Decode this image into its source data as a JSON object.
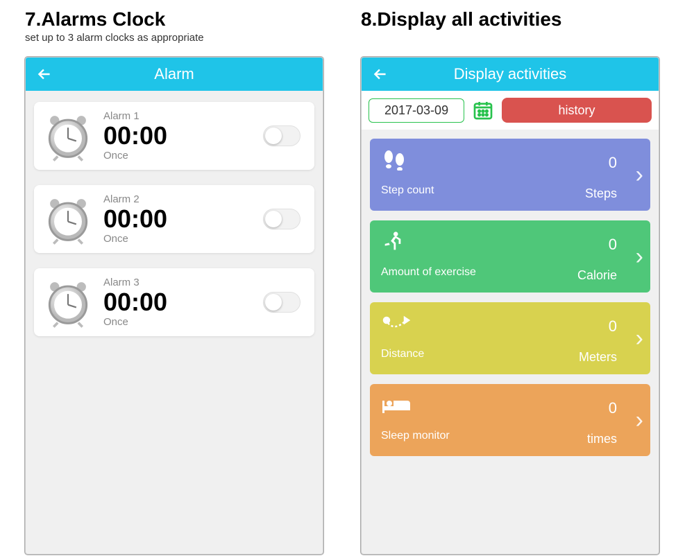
{
  "sections": {
    "s7": {
      "title": "7.Alarms Clock",
      "subtitle": "set up to 3 alarm clocks as appropriate"
    },
    "s8": {
      "title": "8.Display all activities"
    }
  },
  "alarm_screen": {
    "title": "Alarm",
    "alarms": [
      {
        "name": "Alarm 1",
        "time": "00:00",
        "repeat": "Once",
        "on": false
      },
      {
        "name": "Alarm 2",
        "time": "00:00",
        "repeat": "Once",
        "on": false
      },
      {
        "name": "Alarm 3",
        "time": "00:00",
        "repeat": "Once",
        "on": false
      }
    ]
  },
  "activities_screen": {
    "title": "Display activities",
    "date": "2017-03-09",
    "history_label": "history",
    "cards": [
      {
        "icon": "footprints",
        "label": "Step count",
        "value": "0",
        "unit": "Steps"
      },
      {
        "icon": "runner",
        "label": "Amount of exercise",
        "value": "0",
        "unit": "Calorie"
      },
      {
        "icon": "route",
        "label": "Distance",
        "value": "0",
        "unit": "Meters"
      },
      {
        "icon": "bed",
        "label": "Sleep monitor",
        "value": "0",
        "unit": "times"
      }
    ]
  }
}
